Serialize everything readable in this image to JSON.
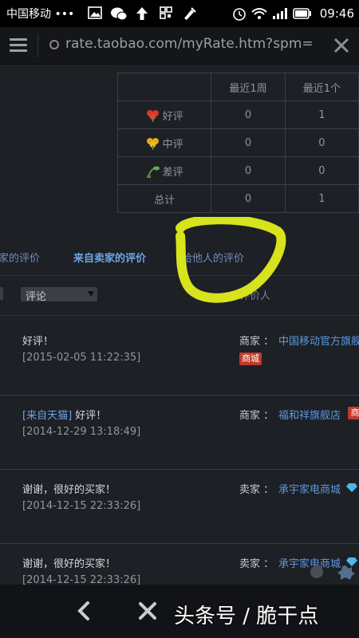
{
  "statusbar": {
    "carrier": "中国移动 •••",
    "time": "09:46",
    "icons": [
      "image-icon",
      "wechat-icon",
      "upload-arrow-icon",
      "grid-icon",
      "cleaner-icon",
      "alarm-icon",
      "wifi-icon",
      "signal-icon",
      "battery-icon"
    ]
  },
  "browser": {
    "url": "rate.taobao.com/myRate.htm?spm=",
    "colors": {
      "bar": "#141619",
      "text": "#9aa0a6"
    }
  },
  "stats_table": {
    "headers": [
      "",
      "最近1周",
      "最近1个"
    ],
    "rows": [
      {
        "label": "好评",
        "icon": "red-flower-icon",
        "week": "0",
        "month": "1"
      },
      {
        "label": "中评",
        "icon": "yellow-flower-icon",
        "week": "0",
        "month": "0"
      },
      {
        "label": "差评",
        "icon": "sprout-icon",
        "week": "0",
        "month": "0"
      },
      {
        "label": "总计",
        "icon": "",
        "week": "0",
        "month": "1"
      }
    ]
  },
  "tabs": {
    "from_buyers": "家的评价",
    "from_sellers": "来自卖家的评价",
    "to_others": "给他人的评价"
  },
  "filter": {
    "select_value": "评论",
    "rater_header": "评价人"
  },
  "reviews": [
    {
      "comment": "好评！",
      "tag": "",
      "date": "[2015-02-05 11:22:35]",
      "role": "商家 ：",
      "shop": "中国移动官方旗舰",
      "badge": "商城"
    },
    {
      "comment": "好评！",
      "tag": "[来自天猫]",
      "date": "[2014-12-29 13:18:49]",
      "role": "商家 ：",
      "shop": "福和祥旗舰店",
      "badge": "商"
    },
    {
      "comment": "谢谢，很好的买家！",
      "tag": "",
      "date": "[2014-12-15 22:33:26]",
      "role": "卖家 ：",
      "shop": "承宇家电商城",
      "badge": ""
    },
    {
      "comment": "谢谢，很好的买家！",
      "tag": "",
      "date": "[2014-12-15 22:33:26]",
      "role": "卖家 ：",
      "shop": "承宇家电商城",
      "badge": ""
    }
  ],
  "watermark": "头条号 / 脆干点",
  "annotation": {
    "color": "#d7e31c"
  },
  "bottom_nav": [
    "back-icon",
    "close-icon"
  ]
}
